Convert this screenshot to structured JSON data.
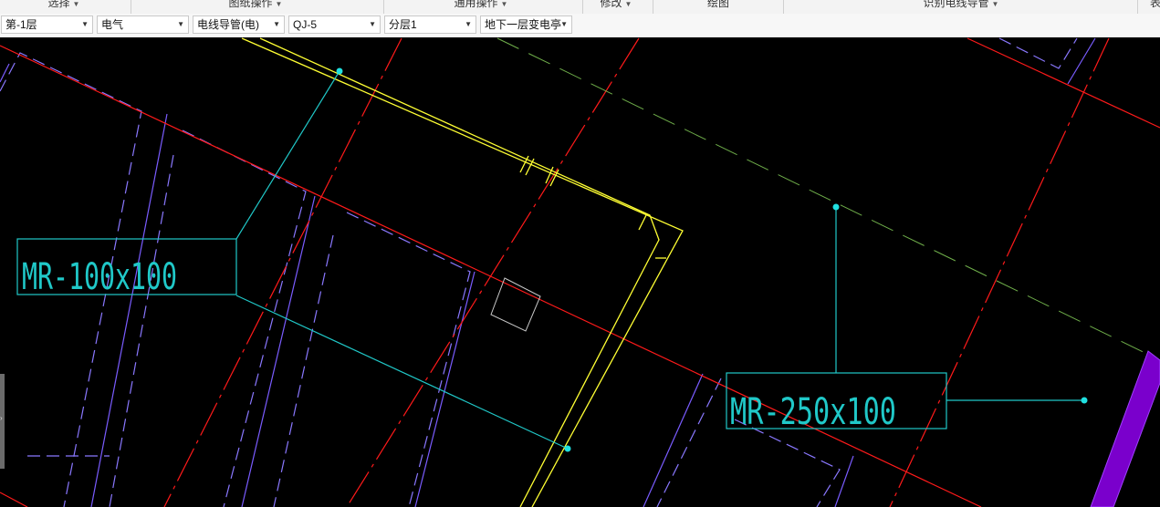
{
  "ribbon": {
    "groups": [
      {
        "label": "选择"
      },
      {
        "label": "图纸操作"
      },
      {
        "label": "通用操作"
      },
      {
        "label": "修改"
      },
      {
        "label": "绘图"
      },
      {
        "label": "识别电线导管"
      },
      {
        "label": "表"
      }
    ]
  },
  "toolbar": {
    "floor_select": "第-1层",
    "discipline_select": "电气",
    "component_type_select": "电线导管(电)",
    "component_name_select": "QJ-5",
    "layer_select": "分层1",
    "area_select": "地下一层变电亭"
  },
  "canvas": {
    "annotation_1": "MR-100x100",
    "annotation_2": "MR-250x100"
  },
  "colors": {
    "background": "#000000",
    "red_line": "#ff1a1a",
    "yellow_wall": "#ffff33",
    "dashed_purple": "#8a78ff",
    "cyan_leader": "#20c8c8",
    "cable_tray_fill": "#7a00cc"
  }
}
